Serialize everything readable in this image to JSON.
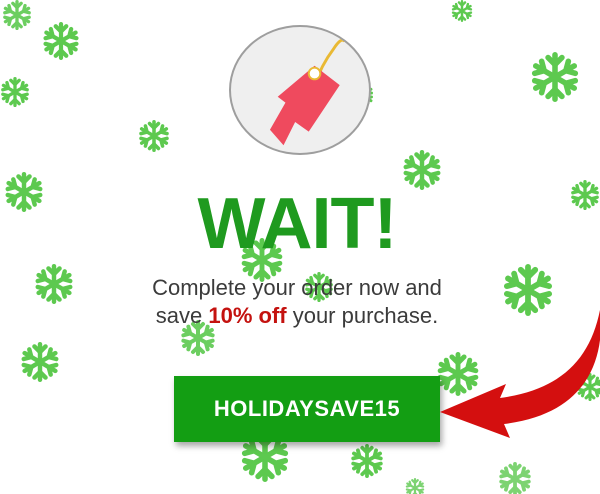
{
  "popup": {
    "headline": "WAIT!",
    "message_line1": "Complete your order now and",
    "message_prefix": "save ",
    "message_highlight": "10% off",
    "message_suffix": " your purchase.",
    "coupon_code": "HOLIDAYSAVE15"
  },
  "icons": {
    "tag": "price-tag-icon",
    "snowflake": "snowflake-icon",
    "arrow": "curved-arrow-icon"
  },
  "colors": {
    "headline": "#1f9a1f",
    "button": "#139e13",
    "highlight": "#c4120f",
    "snowflake": "#5dc94f",
    "tag": "#ef4a5e",
    "arrow": "#d40f0f"
  }
}
